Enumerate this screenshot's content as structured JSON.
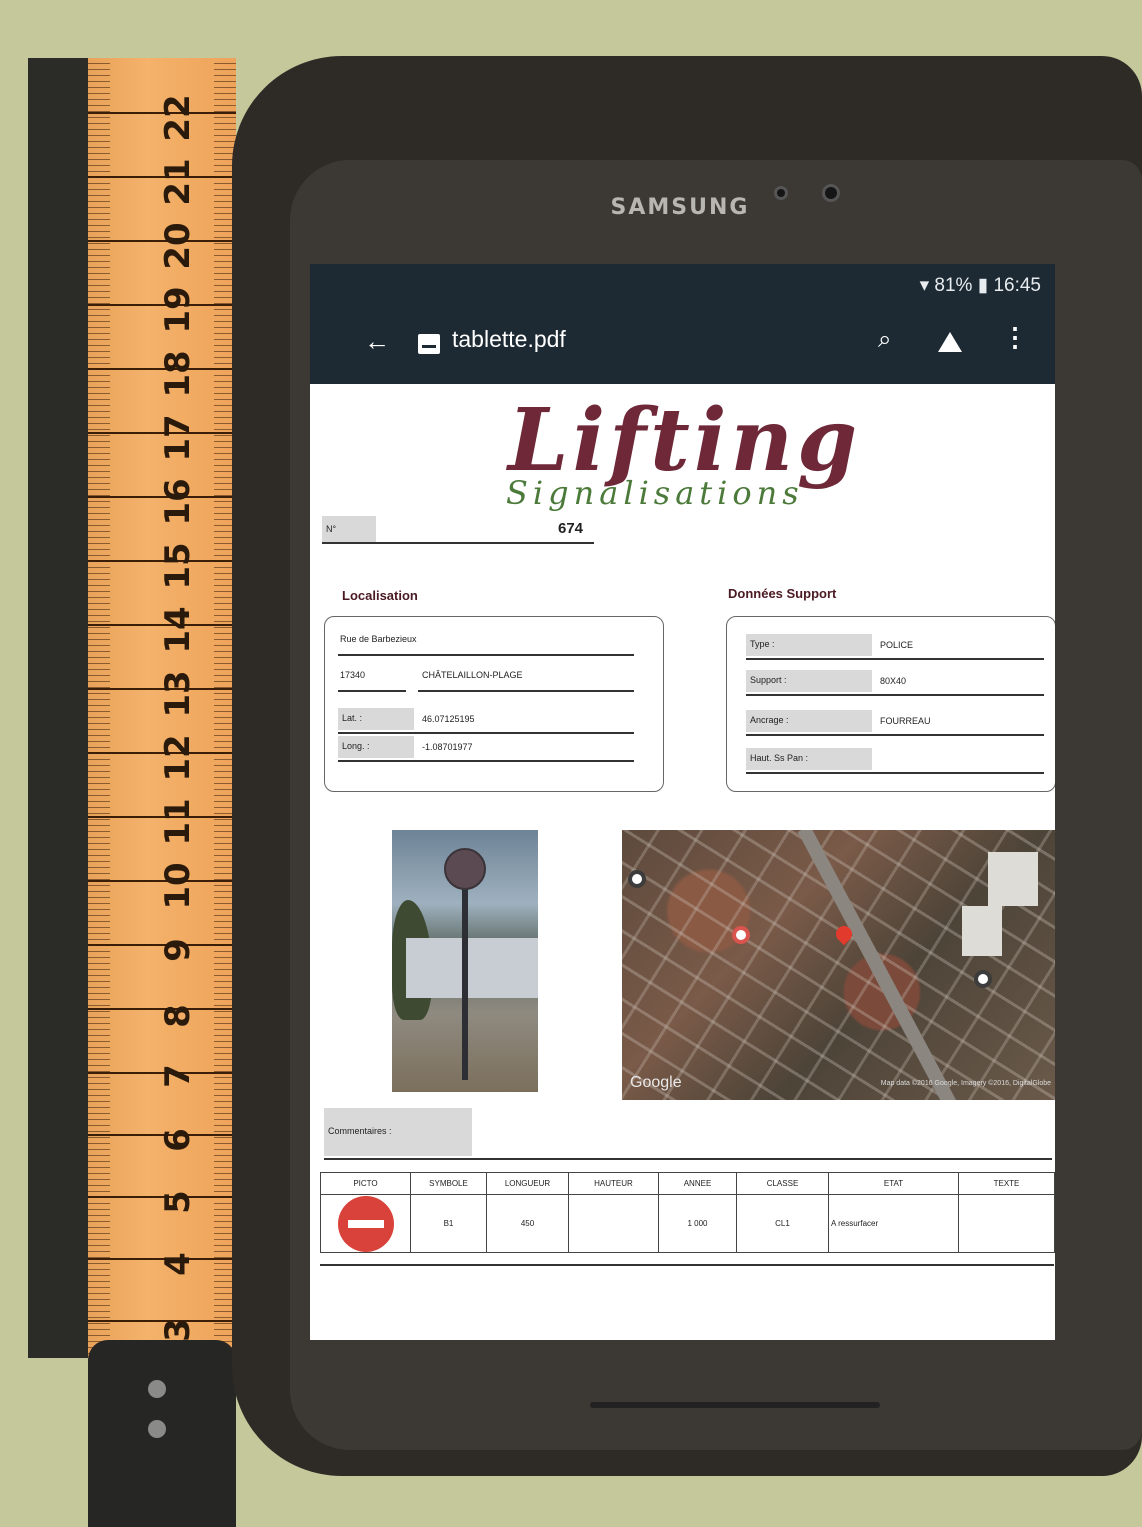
{
  "tape": {
    "numbers": [
      "3",
      "4",
      "5",
      "6",
      "7",
      "8",
      "9",
      "10",
      "11",
      "12",
      "13",
      "14",
      "15",
      "16",
      "17",
      "18",
      "19",
      "20",
      "21",
      "22"
    ]
  },
  "device": {
    "brand": "SAMSUNG"
  },
  "status_bar": {
    "battery": "81%",
    "time": "16:45"
  },
  "app_bar": {
    "title": "tablette.pdf"
  },
  "document": {
    "logo": {
      "main": "Lifting",
      "sub": "Signalisations"
    },
    "number": {
      "label": "N°",
      "value": "674"
    },
    "localisation": {
      "title": "Localisation",
      "street": "Rue de Barbezieux",
      "postcode": "17340",
      "city": "CHÂTELAILLON-PLAGE",
      "lat_label": "Lat. :",
      "lat_value": "46.07125195",
      "long_label": "Long. :",
      "long_value": "-1.08701977"
    },
    "support": {
      "title": "Données Support",
      "type_label": "Type :",
      "type_value": "POLICE",
      "support_label": "Support :",
      "support_value": "80X40",
      "ancrage_label": "Ancrage :",
      "ancrage_value": "FOURREAU",
      "haut_label": "Haut. Ss Pan :",
      "haut_value": ""
    },
    "map": {
      "google": "Google",
      "copyright": "Map data ©2016 Google, Imagery ©2016, DigitalGlobe"
    },
    "comments": {
      "label": "Commentaires :"
    },
    "table": {
      "headers": [
        "PICTO",
        "SYMBOLE",
        "LONGUEUR",
        "HAUTEUR",
        "ANNEE",
        "CLASSE",
        "ETAT",
        "TEXTE"
      ],
      "row": {
        "symbole": "B1",
        "longueur": "450",
        "hauteur": "",
        "annee": "1 000",
        "classe": "CL1",
        "etat": "A ressurfacer",
        "texte": ""
      }
    }
  },
  "colors": {
    "logo_main": "#6e2838",
    "logo_sub": "#4c7a3a",
    "app_bar": "#1d2a33",
    "picto": "#d9423a"
  }
}
